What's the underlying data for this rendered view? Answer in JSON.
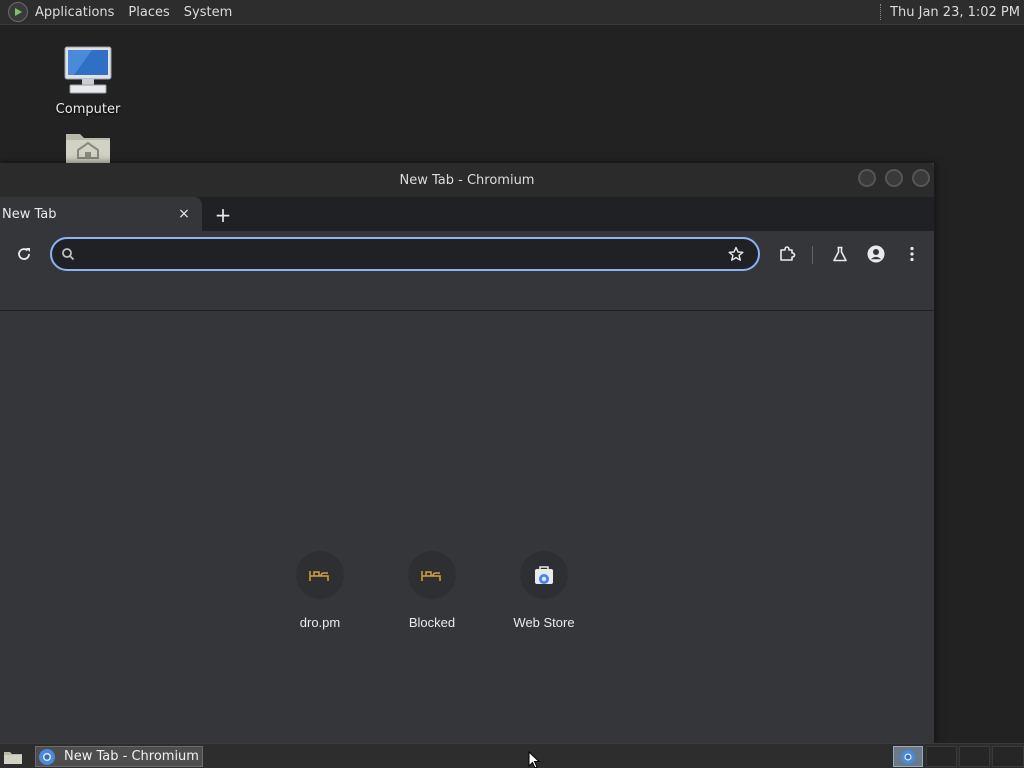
{
  "top_panel": {
    "menus": [
      "Applications",
      "Places",
      "System"
    ],
    "clock": "Thu Jan 23,  1:02 PM"
  },
  "desktop": {
    "icons": [
      {
        "label": "Computer",
        "icon": "computer-icon"
      },
      {
        "label": "",
        "icon": "home-folder-icon"
      }
    ]
  },
  "browser": {
    "window_title": "New Tab - Chromium",
    "tab": {
      "title": "New Tab",
      "close_glyph": "×"
    },
    "new_tab_glyph": "+",
    "omnibox": {
      "value": "",
      "placeholder": ""
    },
    "shortcuts": [
      {
        "label": "dro.pm",
        "icon": "site-favicon-icon"
      },
      {
        "label": "Blocked",
        "icon": "site-favicon-icon"
      },
      {
        "label": "Web Store",
        "icon": "web-store-icon"
      }
    ],
    "accent_color": "#8ab4f8"
  },
  "taskbar": {
    "task_label": "New Tab - Chromium"
  }
}
